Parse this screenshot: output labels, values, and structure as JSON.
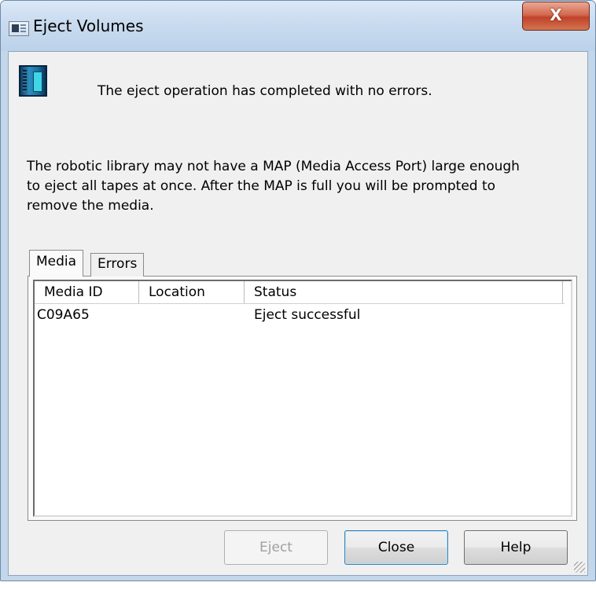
{
  "window": {
    "title": "Eject Volumes",
    "close_glyph": "X",
    "app_icon": "dialog-app-icon"
  },
  "message": {
    "icon": "robotic-library-icon",
    "status": "The eject operation has completed with no errors.",
    "info_lines": [
      "The robotic library may not have a MAP (Media Access Port) large enough",
      "to eject all tapes at once.  After the MAP is full you will be prompted to",
      "remove the media."
    ]
  },
  "tabs": [
    {
      "label": "Media",
      "active": true
    },
    {
      "label": "Errors",
      "active": false
    }
  ],
  "table": {
    "columns": [
      "Media ID",
      "Location",
      "Status"
    ],
    "rows": [
      {
        "media_id": "C09A65",
        "location": "",
        "status": "Eject successful"
      }
    ]
  },
  "buttons": {
    "eject": {
      "label": "Eject",
      "enabled": false
    },
    "close": {
      "label": "Close",
      "enabled": true,
      "default": true
    },
    "help": {
      "label": "Help",
      "enabled": true
    }
  },
  "colors": {
    "frame": "#c3d6ea",
    "client": "#f0f0f0",
    "close_button": "#c7462c"
  }
}
